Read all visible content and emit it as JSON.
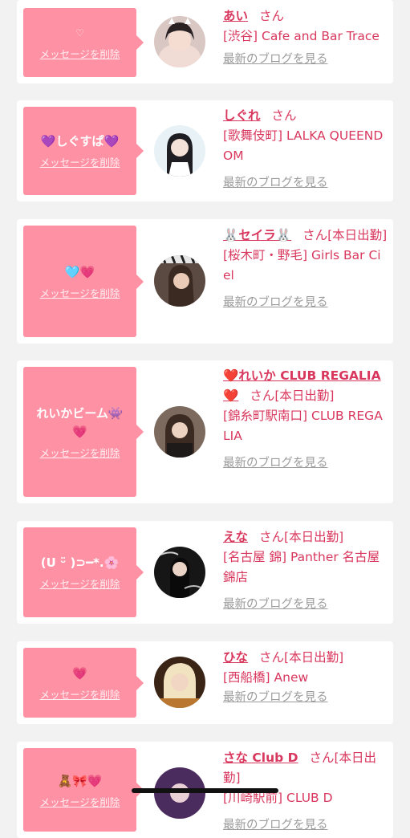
{
  "cards": [
    {
      "bubble_text": "♡",
      "delete_label": "メッセージを削除",
      "name": "あい",
      "honorific": "さん",
      "status": "",
      "shop": "[渋谷] Cafe and Bar Trace",
      "blog_link": "最新のブログを見る",
      "accent_color": "#d9385e"
    },
    {
      "bubble_text": "💜しぐすぱ💜",
      "delete_label": "メッセージを削除",
      "name": "しぐれ",
      "honorific": "さん",
      "status": "",
      "shop": "[歌舞伎町] LALKA QUEENDOM",
      "blog_link": "最新のブログを見る"
    },
    {
      "bubble_text": "🩵💗",
      "delete_label": "メッセージを削除",
      "name": "🐰セイラ🐰",
      "honorific": "さん",
      "status": "[本日出勤]",
      "shop": "[桜木町・野毛] Girls Bar Ciel",
      "blog_link": "最新のブログを見る"
    },
    {
      "bubble_text": "れいかビーム👾💗",
      "delete_label": "メッセージを削除",
      "name": "❤️れいか CLUB REGALIA❤️",
      "honorific": "さん",
      "status": "[本日出勤]",
      "shop": "[錦糸町駅南口] CLUB REGALIA",
      "blog_link": "最新のブログを見る"
    },
    {
      "bubble_text": "(U ᵕ̈ )⊃━*.🌸",
      "delete_label": "メッセージを削除",
      "name": "えな",
      "honorific": "さん",
      "status": "[本日出勤]",
      "shop": "[名古屋 錦] Panther 名古屋錦店",
      "blog_link": "最新のブログを見る"
    },
    {
      "bubble_text": "💗",
      "delete_label": "メッセージを削除",
      "name": "ひな",
      "honorific": "さん",
      "status": "[本日出勤]",
      "shop": "[西船橋] Anew",
      "blog_link": "最新のブログを見る"
    },
    {
      "bubble_text": "🧸🎀💗",
      "delete_label": "メッセージを削除",
      "name": "さな Club D",
      "honorific": "さん",
      "status": "[本日出勤]",
      "shop": "[川崎駅前] CLUB D",
      "blog_link": "最新のブログを見る"
    }
  ],
  "colors": {
    "bubble": "#ff91a4",
    "name": "#d9385e",
    "link": "#9b9b9b",
    "background": "#f2f2f2"
  },
  "icons": [
    "avatar-photo",
    "home-indicator"
  ]
}
